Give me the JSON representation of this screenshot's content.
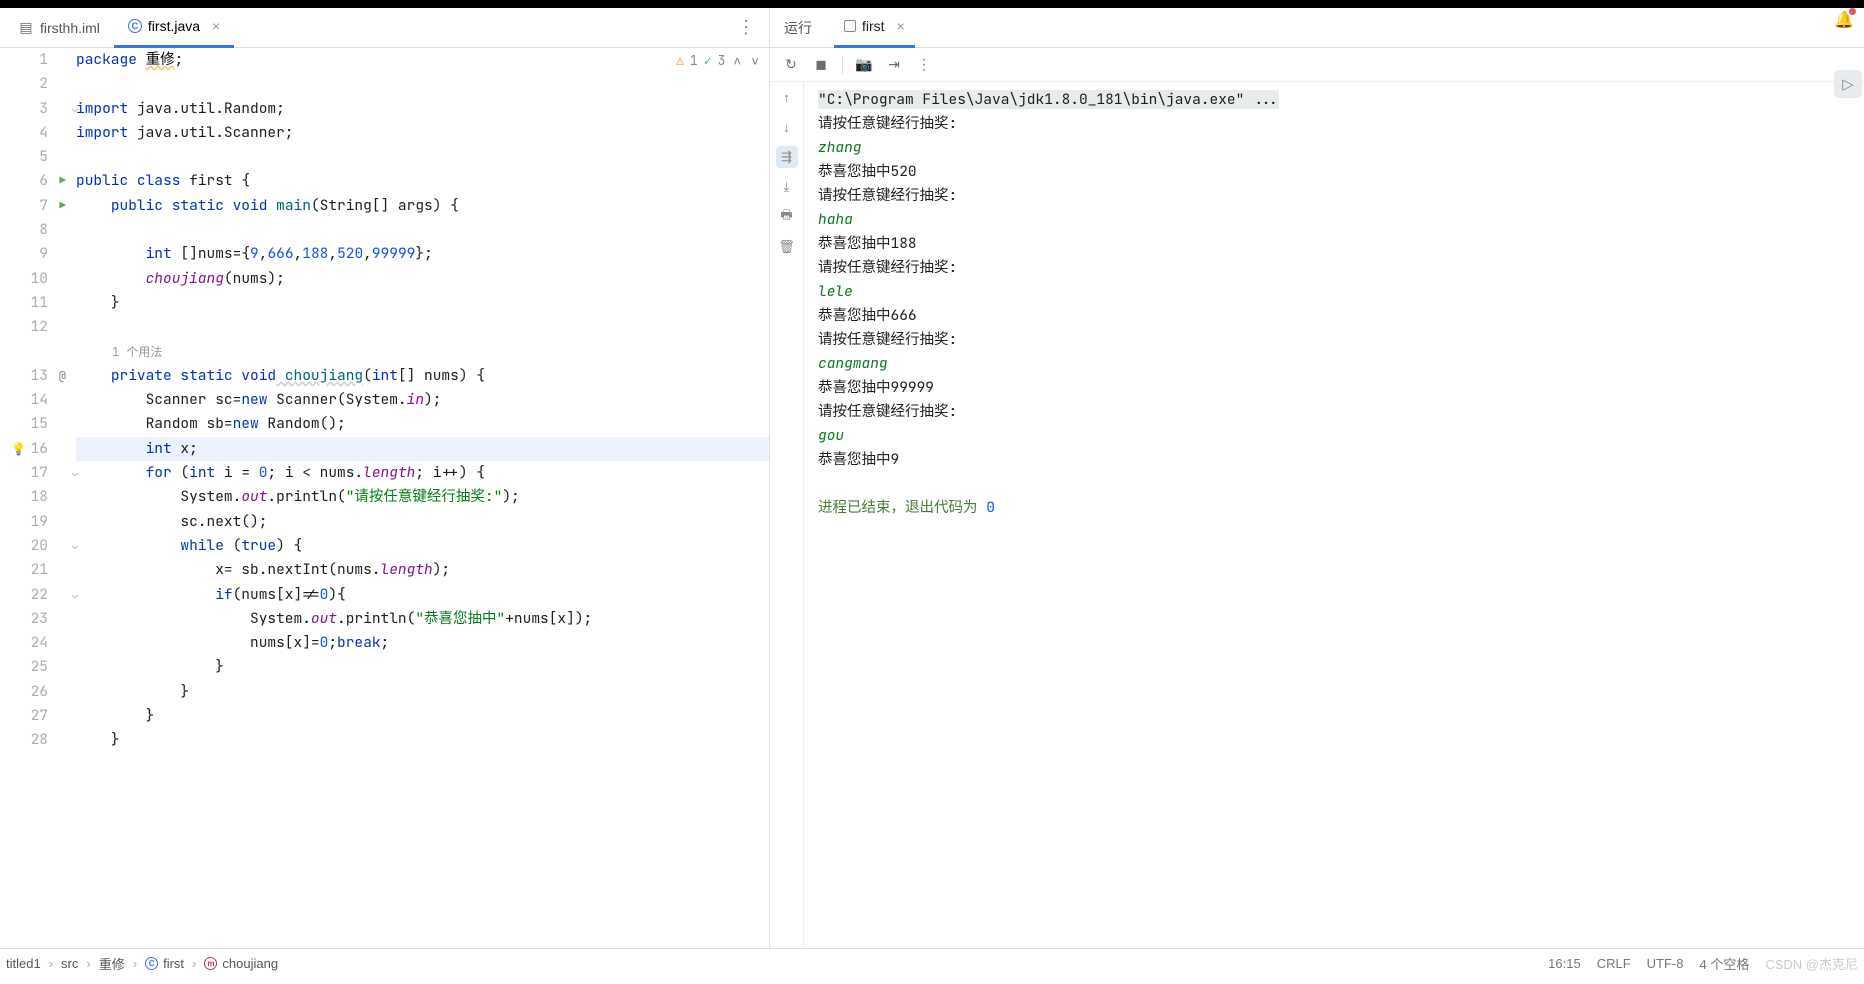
{
  "tabs": [
    {
      "label": "firsthh.iml",
      "active": false
    },
    {
      "label": "first.java",
      "active": true
    }
  ],
  "inspect": {
    "warnings": "1",
    "weak": "3"
  },
  "inlay_usage": "1 个用法",
  "code": {
    "l1_kw": "package",
    "l1_pkg": "重修",
    "l1_end": ";",
    "l3": "import",
    "l3_rest": " java.util.Random;",
    "l4": "import",
    "l4_rest": " java.util.Scanner;",
    "l6_kw": "public class",
    "l6_name": " first ",
    "l6_brace": "{",
    "l7_kw": "public static void",
    "l7_name": " main",
    "l7_params": "(String[] args) {",
    "l9_kw": "int",
    "l9_a": " []nums={",
    "l9_n1": "9",
    "l9_c": ",",
    "l9_n2": "666",
    "l9_n3": "188",
    "l9_n4": "520",
    "l9_n5": "99999",
    "l9_end": "};",
    "l10": "choujiang",
    "l10_end": "(nums);",
    "l11": "}",
    "l13_kw": "private static void",
    "l13_name": " choujiang",
    "l13_p": "(",
    "l13_kw2": "int",
    "l13_rest": "[] nums) {",
    "l14_a": "Scanner sc=",
    "l14_kw": "new",
    "l14_b": " Scanner(System.",
    "l14_fld": "in",
    "l14_end": ");",
    "l15_a": "Random sb=",
    "l15_kw": "new",
    "l15_b": " Random();",
    "l16_kw": "int",
    "l16_rest": " x;",
    "l17_kw": "for",
    "l17_a": " (",
    "l17_kw2": "int",
    "l17_b": " i = ",
    "l17_n": "0",
    "l17_c": "; i < nums.",
    "l17_fld": "length",
    "l17_d": "; i++) {",
    "l18_a": "System.",
    "l18_fld": "out",
    "l18_b": ".println(",
    "l18_str": "\"请按任意键经行抽奖:\"",
    "l18_end": ");",
    "l19": "sc.next();",
    "l20_kw": "while",
    "l20_a": " (",
    "l20_kw2": "true",
    "l20_b": ") {",
    "l21_a": "x= sb.nextInt(nums.",
    "l21_fld": "length",
    "l21_end": ");",
    "l22_kw": "if",
    "l22_a": "(nums[x]!=",
    "l22_n": "0",
    "l22_b": "){",
    "l23_a": "System.",
    "l23_fld": "out",
    "l23_b": ".println(",
    "l23_str": "\"恭喜您抽中\"",
    "l23_c": "+nums[x]);",
    "l24_a": "nums[x]=",
    "l24_n": "0",
    "l24_b": ";",
    "l24_kw": "break",
    "l24_end": ";",
    "l25": "}",
    "l26": "}",
    "l27": "}",
    "l28": "}"
  },
  "run": {
    "title": "运行",
    "tab": "first",
    "cmd": "\"C:\\Program Files\\Java\\jdk1.8.0_181\\bin\\java.exe\" ...",
    "lines": [
      {
        "t": "plain",
        "v": "请按任意键经行抽奖:"
      },
      {
        "t": "input",
        "v": "zhang"
      },
      {
        "t": "plain",
        "v": "恭喜您抽中520"
      },
      {
        "t": "plain",
        "v": "请按任意键经行抽奖:"
      },
      {
        "t": "input",
        "v": "haha"
      },
      {
        "t": "plain",
        "v": "恭喜您抽中188"
      },
      {
        "t": "plain",
        "v": "请按任意键经行抽奖:"
      },
      {
        "t": "input",
        "v": "lele"
      },
      {
        "t": "plain",
        "v": "恭喜您抽中666"
      },
      {
        "t": "plain",
        "v": "请按任意键经行抽奖:"
      },
      {
        "t": "input",
        "v": "cangmang"
      },
      {
        "t": "plain",
        "v": "恭喜您抽中99999"
      },
      {
        "t": "plain",
        "v": "请按任意键经行抽奖:"
      },
      {
        "t": "input",
        "v": "gou"
      },
      {
        "t": "plain",
        "v": "恭喜您抽中9"
      }
    ],
    "exit_text": "进程已结束，退出代码为 ",
    "exit_code": "0"
  },
  "breadcrumb": {
    "items": [
      "titled1",
      "src",
      "重修",
      "first",
      "choujiang"
    ]
  },
  "status": {
    "position": "16:15",
    "eol": "CRLF",
    "encoding": "UTF-8",
    "indent": "4 个空格"
  },
  "watermark": "CSDN @杰克尼"
}
